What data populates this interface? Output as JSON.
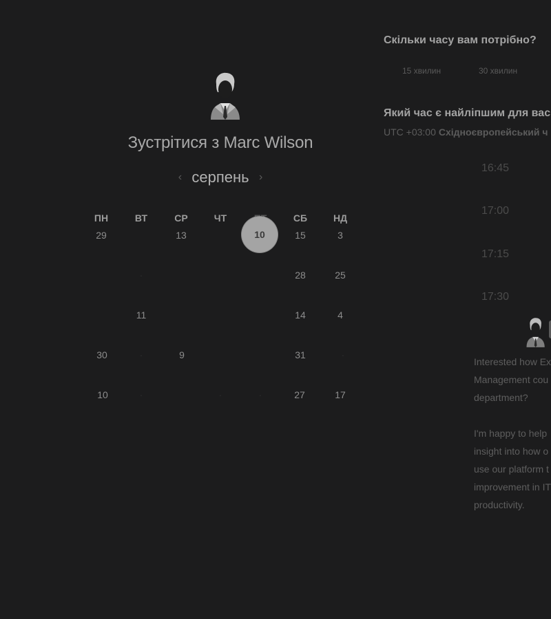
{
  "calendar": {
    "title": "Зустрітися з Marc Wilson",
    "month": "серпень",
    "prev_arrow": "‹",
    "next_arrow": "›",
    "weekdays": [
      "ПН",
      "ВТ",
      "СР",
      "ЧТ",
      "ПТ",
      "СБ",
      "НД"
    ],
    "rows": [
      [
        "29",
        "",
        "13",
        "",
        "10",
        "15",
        "3"
      ],
      [
        "",
        "",
        "",
        "",
        "",
        "28",
        "25"
      ],
      [
        "",
        "11",
        "",
        "",
        "",
        "14",
        "4"
      ],
      [
        "30",
        "",
        "9",
        "",
        "",
        "31",
        ""
      ],
      [
        "10",
        "",
        "",
        "",
        "",
        "27",
        "17"
      ]
    ],
    "selected_day": "10"
  },
  "duration": {
    "question": "Скільки часу вам потрібно?",
    "options": [
      "15 хвилин",
      "30 хвилин"
    ]
  },
  "time": {
    "question": "Який час є найліпшим для вас",
    "tz_offset": "UTC +03:00",
    "tz_name": "Східноєвропейський ч",
    "slots": [
      "16:45",
      "17:00",
      "17:15",
      "17:30"
    ]
  },
  "intro": {
    "paragraph1": [
      "Interested how Ex",
      "Management cou",
      "department?"
    ],
    "paragraph2": [
      "I'm happy to help",
      "insight into how o",
      "use our platform t",
      "improvement in IT",
      "productivity."
    ]
  },
  "colors": {
    "background": "#1c1c1d",
    "selected_day": "#a4a4a4"
  }
}
